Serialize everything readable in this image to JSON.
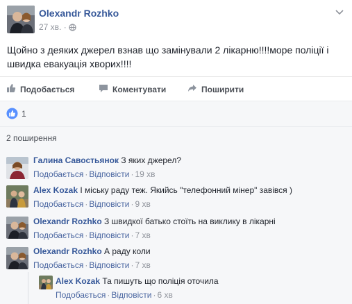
{
  "post": {
    "author": "Olexandr Rozhko",
    "time": "27 хв.",
    "text": "Щойно з деяких джерел взнав що замінували 2 лікарню!!!!море поліції і швидка евакуація хворих!!!!"
  },
  "actions": {
    "like": "Подобається",
    "comment": "Коментувати",
    "share": "Поширити"
  },
  "reactions": {
    "count": "1"
  },
  "shares": {
    "label": "2 поширення"
  },
  "comment_actions": {
    "like": "Подобається",
    "reply": "Відповісти"
  },
  "comments": [
    {
      "author": "Галина Савостьянок",
      "text": "З яких джерел?",
      "time": "19 хв"
    },
    {
      "author": "Alex Kozak",
      "text": "І міську раду теж. Якийсь \"телефонний мінер\" завівся )",
      "time": "9 хв"
    },
    {
      "author": "Olexandr Rozhko",
      "text": "З швидкої батько стоїть на виклику в лікарні",
      "time": "7 хв"
    },
    {
      "author": "Olexandr Rozhko",
      "text": "А раду коли",
      "time": "7 хв"
    }
  ],
  "reply": {
    "author": "Alex Kozak",
    "text": "Та пишуть що поліція оточила",
    "time": "6 хв"
  },
  "colors": {
    "link": "#365899",
    "like_blue": "#5890ff",
    "background": "#f6f7f9"
  },
  "icons": [
    "chevron-down-icon",
    "globe-icon",
    "thumbs-up-icon",
    "comment-icon",
    "share-icon",
    "like-reaction-icon"
  ]
}
